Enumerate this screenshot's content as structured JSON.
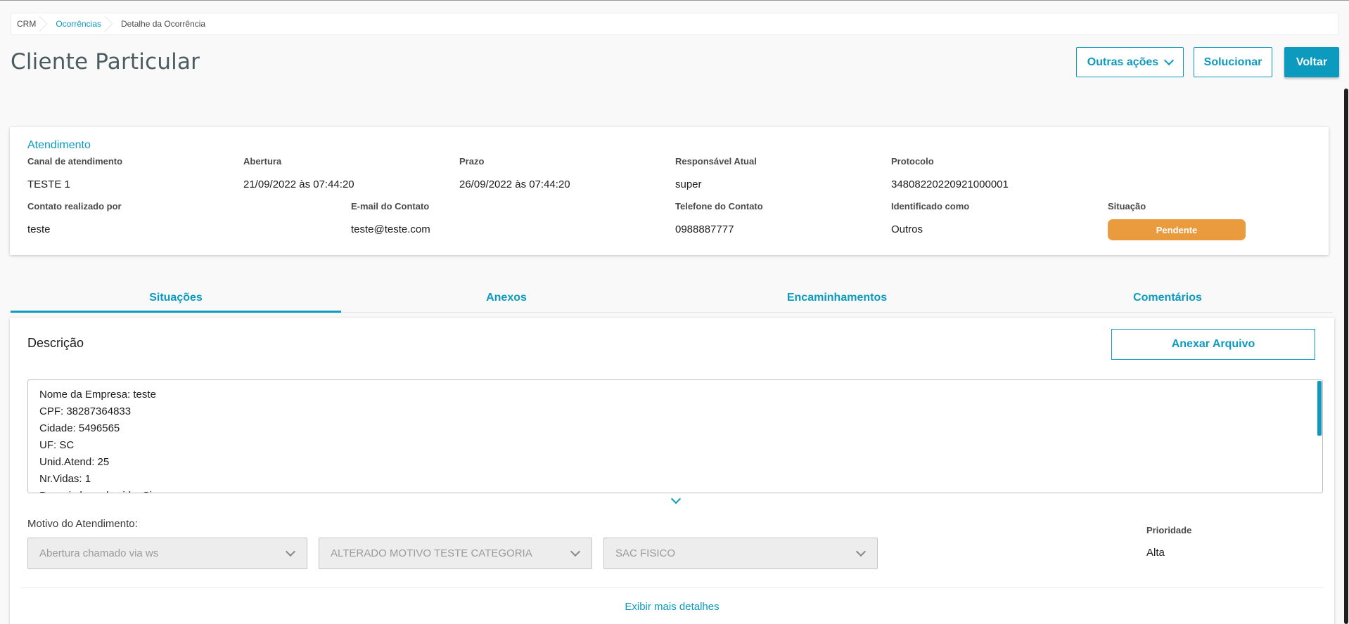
{
  "breadcrumb": {
    "items": [
      {
        "label": "CRM"
      },
      {
        "label": "Ocorrências"
      },
      {
        "label": "Detalhe da Ocorrência"
      }
    ]
  },
  "header": {
    "title": "Cliente Particular",
    "other_actions_label": "Outras ações",
    "resolve_label": "Solucionar",
    "back_label": "Voltar"
  },
  "atendimento": {
    "title": "Atendimento",
    "fields": {
      "canal": {
        "label": "Canal de atendimento",
        "value": "TESTE 1"
      },
      "abertura": {
        "label": "Abertura",
        "value": "21/09/2022 às 07:44:20"
      },
      "prazo": {
        "label": "Prazo",
        "value": "26/09/2022 às 07:44:20"
      },
      "responsavel": {
        "label": "Responsável Atual",
        "value": "super"
      },
      "protocolo": {
        "label": "Protocolo",
        "value": "34808220220921000001"
      },
      "contato": {
        "label": "Contato realizado por",
        "value": "teste"
      },
      "email": {
        "label": "E-mail do Contato",
        "value": "teste@teste.com"
      },
      "telefone": {
        "label": "Telefone do Contato",
        "value": "0988887777"
      },
      "identificado": {
        "label": "Identificado como",
        "value": "Outros"
      },
      "situacao": {
        "label": "Situação",
        "value": "Pendente"
      }
    },
    "status_color": "#ea9b3e"
  },
  "tabs": [
    {
      "label": "Situações",
      "active": true
    },
    {
      "label": "Anexos",
      "active": false
    },
    {
      "label": "Encaminhamentos",
      "active": false
    },
    {
      "label": "Comentários",
      "active": false
    }
  ],
  "descricao": {
    "title": "Descrição",
    "attach_label": "Anexar Arquivo",
    "lines": [
      "Nome da Empresa: teste",
      "CPF: 38287364833",
      "Cidade: 5496565",
      "UF: SC",
      "Unid.Atend: 25",
      "Nr.Vidas: 1",
      "Possui plano de vida: Sim"
    ]
  },
  "motivo": {
    "label": "Motivo do Atendimento:",
    "select1": "Abertura chamado via ws",
    "select2": "ALTERADO MOTIVO TESTE CATEGORIA",
    "select3": "SAC FISICO"
  },
  "prioridade": {
    "label": "Prioridade",
    "value": "Alta"
  },
  "footer": {
    "more_details_label": "Exibir mais detalhes"
  },
  "colors": {
    "accent": "#0c9abe",
    "background": "#f9f9f9"
  }
}
